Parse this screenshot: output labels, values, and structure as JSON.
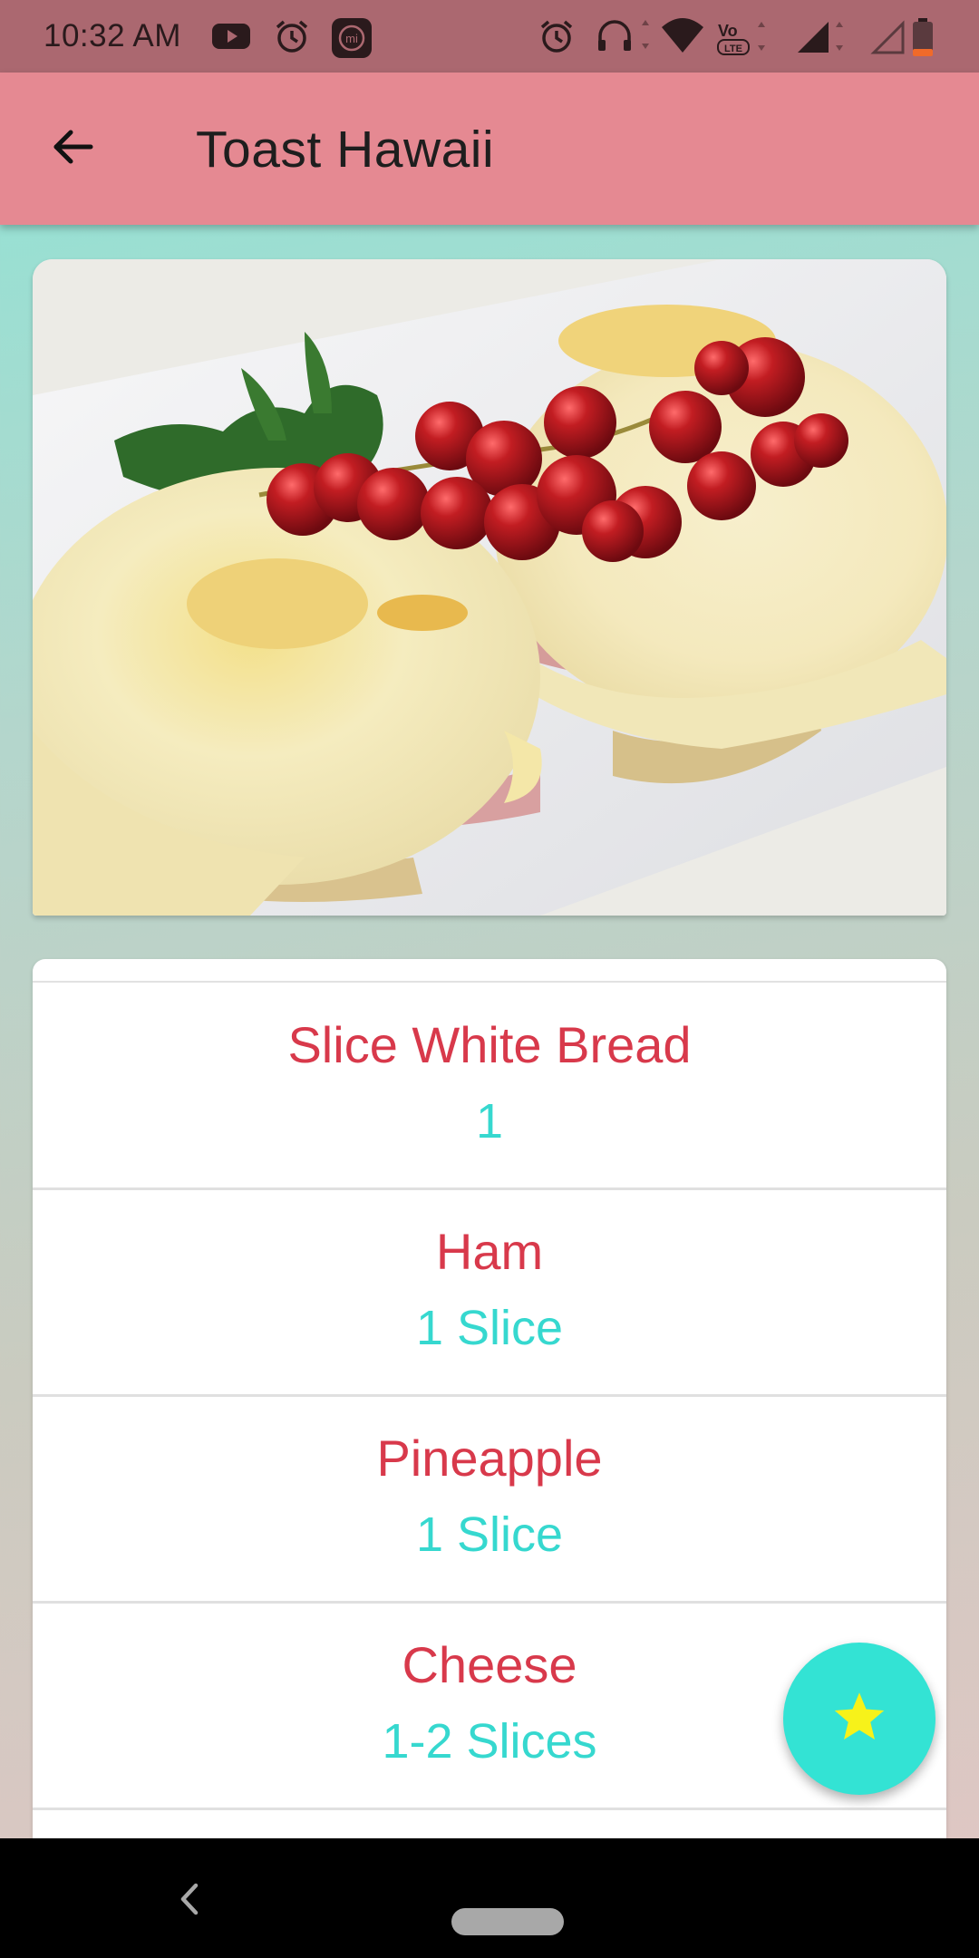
{
  "status_bar": {
    "time": "10:32 AM",
    "left_icons": [
      "youtube-icon",
      "alarm-icon",
      "mi-app-icon"
    ],
    "right_icons": [
      "alarm-icon",
      "headphones-icon",
      "wifi-icon",
      "volte-icon",
      "signal-icon",
      "signal-empty-icon",
      "battery-low-icon"
    ],
    "volte_label": "VoLTE",
    "mi_label": "mi"
  },
  "app_bar": {
    "title": "Toast Hawaii",
    "back_icon": "arrow-back-icon",
    "background": "#e58992"
  },
  "recipe_image": {
    "subject": "toast-hawaii-photo"
  },
  "ingredients": [
    {
      "name": "Slice White Bread",
      "quantity": "1"
    },
    {
      "name": "Ham",
      "quantity": "1 Slice"
    },
    {
      "name": "Pineapple",
      "quantity": "1 Slice"
    },
    {
      "name": "Cheese",
      "quantity": "1-2 Slices"
    }
  ],
  "fab": {
    "icon": "star-icon",
    "background": "#33e3d4",
    "icon_color": "#f7f21a"
  },
  "colors": {
    "ingredient_name": "#d8394b",
    "ingredient_quantity": "#36d8cf",
    "status_bar": "#ab6870"
  }
}
